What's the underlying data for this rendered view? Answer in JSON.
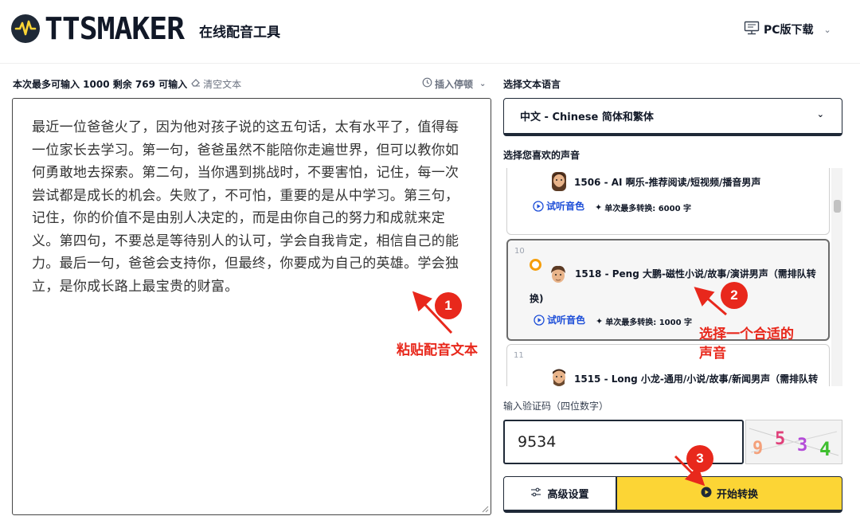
{
  "header": {
    "logo_text": "TTSMAKER",
    "tagline": "在线配音工具",
    "pc_download": "PC版下载",
    "icons": {
      "logo": "waveform-logo-icon",
      "monitor": "monitor-icon",
      "chevron": "chevron-down-icon"
    }
  },
  "editor": {
    "input_info": "本次最多可输入 1000 剩余 769 可输入",
    "clear_text": "清空文本",
    "insert_pause": "插入停顿",
    "text": "最近一位爸爸火了，因为他对孩子说的这五句话，太有水平了，值得每一位家长去学习。第一句，爸爸虽然不能陪你走遍世界，但可以教你如何勇敢地去探索。第二句，当你遇到挑战时，不要害怕，记住，每一次尝试都是成长的机会。失败了，不可怕，重要的是从中学习。第三句，记住，你的价值不是由别人决定的，而是由你自己的努力和成就来定义。第四句，不要总是等待别人的认可，学会自我肯定，相信自己的能力。最后一句，爸爸会支持你，但最终，你要成为自己的英雄。学会独立，是你成长路上最宝贵的财富。"
  },
  "language": {
    "label": "选择文本语言",
    "selected": "中文 - Chinese 简体和繁体"
  },
  "voices": {
    "label": "选择您喜欢的声音",
    "listen_label": "试听音色",
    "items": [
      {
        "number": "",
        "name": "1506 - AI 啊乐-推荐阅读/短视频/播音男声",
        "limit": "单次最多转换: 6000 字",
        "selected": false
      },
      {
        "number": "10",
        "name_line1": "1518 - Peng 大鹏-磁性小说/故事/演讲男声（需排队转",
        "name_line2": "换)",
        "limit": "单次最多转换: 1000 字",
        "selected": true
      },
      {
        "number": "11",
        "name": "1515 - Long 小龙-通用/小说/故事/新闻男声（需排队转",
        "selected": false
      }
    ]
  },
  "captcha": {
    "label": "输入验证码（四位数字）",
    "value": "9534",
    "image_chars": [
      "9",
      "5",
      "3",
      "4"
    ],
    "image_colors": [
      "#f4a07a",
      "#e0407a",
      "#b44bd8",
      "#3fbf2f"
    ]
  },
  "actions": {
    "advanced": "高级设置",
    "start": "开始转换"
  },
  "annotations": {
    "step1": "1",
    "step1_label": "粘贴配音文本",
    "step2": "2",
    "step2_label_line1": "选择一个合适的",
    "step2_label_line2": "声音",
    "step3": "3",
    "color": "#e8281c"
  },
  "colors": {
    "accent_yellow": "#fcd535",
    "link_blue": "#1d4ed8",
    "radio_orange": "#f59e0b"
  }
}
